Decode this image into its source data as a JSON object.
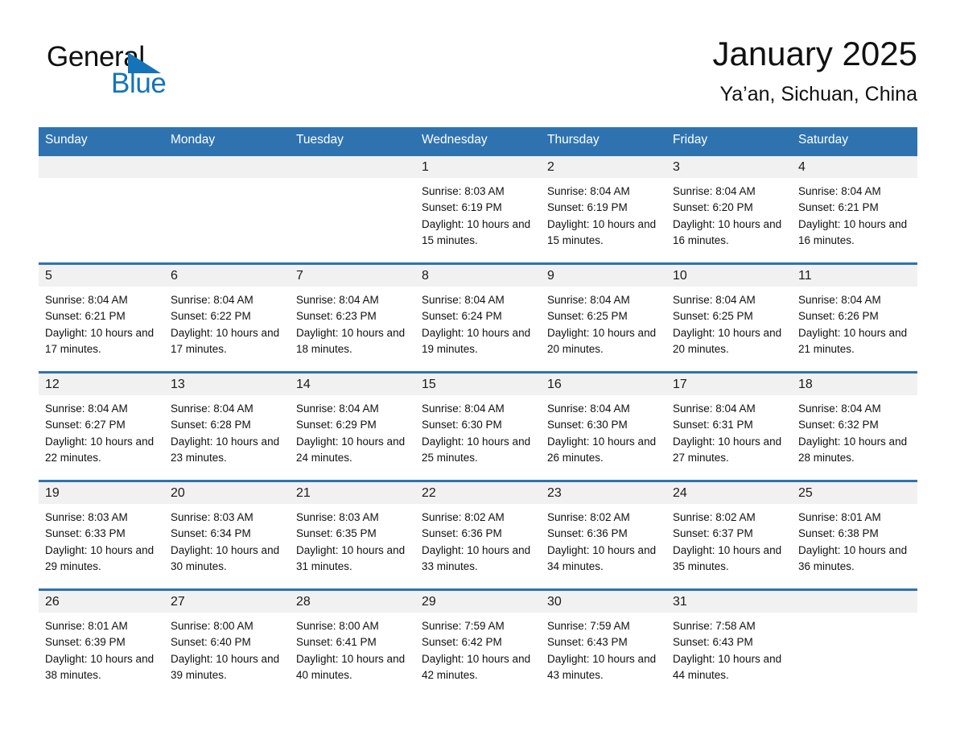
{
  "brand": {
    "name_part1": "General",
    "name_part2": "Blue",
    "accent_color": "#1574b8",
    "logo_icon": "triangle-icon"
  },
  "header": {
    "title": "January 2025",
    "subtitle": "Ya’an, Sichuan, China"
  },
  "calendar": {
    "header_bg": "#2e73b0",
    "daynumber_bg": "#f1f1f1",
    "weekday_headers": [
      "Sunday",
      "Monday",
      "Tuesday",
      "Wednesday",
      "Thursday",
      "Friday",
      "Saturday"
    ],
    "weeks": [
      [
        {
          "day": "",
          "sunrise": "",
          "sunset": "",
          "daylight": ""
        },
        {
          "day": "",
          "sunrise": "",
          "sunset": "",
          "daylight": ""
        },
        {
          "day": "",
          "sunrise": "",
          "sunset": "",
          "daylight": ""
        },
        {
          "day": "1",
          "sunrise": "Sunrise: 8:03 AM",
          "sunset": "Sunset: 6:19 PM",
          "daylight": "Daylight: 10 hours and 15 minutes."
        },
        {
          "day": "2",
          "sunrise": "Sunrise: 8:04 AM",
          "sunset": "Sunset: 6:19 PM",
          "daylight": "Daylight: 10 hours and 15 minutes."
        },
        {
          "day": "3",
          "sunrise": "Sunrise: 8:04 AM",
          "sunset": "Sunset: 6:20 PM",
          "daylight": "Daylight: 10 hours and 16 minutes."
        },
        {
          "day": "4",
          "sunrise": "Sunrise: 8:04 AM",
          "sunset": "Sunset: 6:21 PM",
          "daylight": "Daylight: 10 hours and 16 minutes."
        }
      ],
      [
        {
          "day": "5",
          "sunrise": "Sunrise: 8:04 AM",
          "sunset": "Sunset: 6:21 PM",
          "daylight": "Daylight: 10 hours and 17 minutes."
        },
        {
          "day": "6",
          "sunrise": "Sunrise: 8:04 AM",
          "sunset": "Sunset: 6:22 PM",
          "daylight": "Daylight: 10 hours and 17 minutes."
        },
        {
          "day": "7",
          "sunrise": "Sunrise: 8:04 AM",
          "sunset": "Sunset: 6:23 PM",
          "daylight": "Daylight: 10 hours and 18 minutes."
        },
        {
          "day": "8",
          "sunrise": "Sunrise: 8:04 AM",
          "sunset": "Sunset: 6:24 PM",
          "daylight": "Daylight: 10 hours and 19 minutes."
        },
        {
          "day": "9",
          "sunrise": "Sunrise: 8:04 AM",
          "sunset": "Sunset: 6:25 PM",
          "daylight": "Daylight: 10 hours and 20 minutes."
        },
        {
          "day": "10",
          "sunrise": "Sunrise: 8:04 AM",
          "sunset": "Sunset: 6:25 PM",
          "daylight": "Daylight: 10 hours and 20 minutes."
        },
        {
          "day": "11",
          "sunrise": "Sunrise: 8:04 AM",
          "sunset": "Sunset: 6:26 PM",
          "daylight": "Daylight: 10 hours and 21 minutes."
        }
      ],
      [
        {
          "day": "12",
          "sunrise": "Sunrise: 8:04 AM",
          "sunset": "Sunset: 6:27 PM",
          "daylight": "Daylight: 10 hours and 22 minutes."
        },
        {
          "day": "13",
          "sunrise": "Sunrise: 8:04 AM",
          "sunset": "Sunset: 6:28 PM",
          "daylight": "Daylight: 10 hours and 23 minutes."
        },
        {
          "day": "14",
          "sunrise": "Sunrise: 8:04 AM",
          "sunset": "Sunset: 6:29 PM",
          "daylight": "Daylight: 10 hours and 24 minutes."
        },
        {
          "day": "15",
          "sunrise": "Sunrise: 8:04 AM",
          "sunset": "Sunset: 6:30 PM",
          "daylight": "Daylight: 10 hours and 25 minutes."
        },
        {
          "day": "16",
          "sunrise": "Sunrise: 8:04 AM",
          "sunset": "Sunset: 6:30 PM",
          "daylight": "Daylight: 10 hours and 26 minutes."
        },
        {
          "day": "17",
          "sunrise": "Sunrise: 8:04 AM",
          "sunset": "Sunset: 6:31 PM",
          "daylight": "Daylight: 10 hours and 27 minutes."
        },
        {
          "day": "18",
          "sunrise": "Sunrise: 8:04 AM",
          "sunset": "Sunset: 6:32 PM",
          "daylight": "Daylight: 10 hours and 28 minutes."
        }
      ],
      [
        {
          "day": "19",
          "sunrise": "Sunrise: 8:03 AM",
          "sunset": "Sunset: 6:33 PM",
          "daylight": "Daylight: 10 hours and 29 minutes."
        },
        {
          "day": "20",
          "sunrise": "Sunrise: 8:03 AM",
          "sunset": "Sunset: 6:34 PM",
          "daylight": "Daylight: 10 hours and 30 minutes."
        },
        {
          "day": "21",
          "sunrise": "Sunrise: 8:03 AM",
          "sunset": "Sunset: 6:35 PM",
          "daylight": "Daylight: 10 hours and 31 minutes."
        },
        {
          "day": "22",
          "sunrise": "Sunrise: 8:02 AM",
          "sunset": "Sunset: 6:36 PM",
          "daylight": "Daylight: 10 hours and 33 minutes."
        },
        {
          "day": "23",
          "sunrise": "Sunrise: 8:02 AM",
          "sunset": "Sunset: 6:36 PM",
          "daylight": "Daylight: 10 hours and 34 minutes."
        },
        {
          "day": "24",
          "sunrise": "Sunrise: 8:02 AM",
          "sunset": "Sunset: 6:37 PM",
          "daylight": "Daylight: 10 hours and 35 minutes."
        },
        {
          "day": "25",
          "sunrise": "Sunrise: 8:01 AM",
          "sunset": "Sunset: 6:38 PM",
          "daylight": "Daylight: 10 hours and 36 minutes."
        }
      ],
      [
        {
          "day": "26",
          "sunrise": "Sunrise: 8:01 AM",
          "sunset": "Sunset: 6:39 PM",
          "daylight": "Daylight: 10 hours and 38 minutes."
        },
        {
          "day": "27",
          "sunrise": "Sunrise: 8:00 AM",
          "sunset": "Sunset: 6:40 PM",
          "daylight": "Daylight: 10 hours and 39 minutes."
        },
        {
          "day": "28",
          "sunrise": "Sunrise: 8:00 AM",
          "sunset": "Sunset: 6:41 PM",
          "daylight": "Daylight: 10 hours and 40 minutes."
        },
        {
          "day": "29",
          "sunrise": "Sunrise: 7:59 AM",
          "sunset": "Sunset: 6:42 PM",
          "daylight": "Daylight: 10 hours and 42 minutes."
        },
        {
          "day": "30",
          "sunrise": "Sunrise: 7:59 AM",
          "sunset": "Sunset: 6:43 PM",
          "daylight": "Daylight: 10 hours and 43 minutes."
        },
        {
          "day": "31",
          "sunrise": "Sunrise: 7:58 AM",
          "sunset": "Sunset: 6:43 PM",
          "daylight": "Daylight: 10 hours and 44 minutes."
        },
        {
          "day": "",
          "sunrise": "",
          "sunset": "",
          "daylight": ""
        }
      ]
    ]
  }
}
